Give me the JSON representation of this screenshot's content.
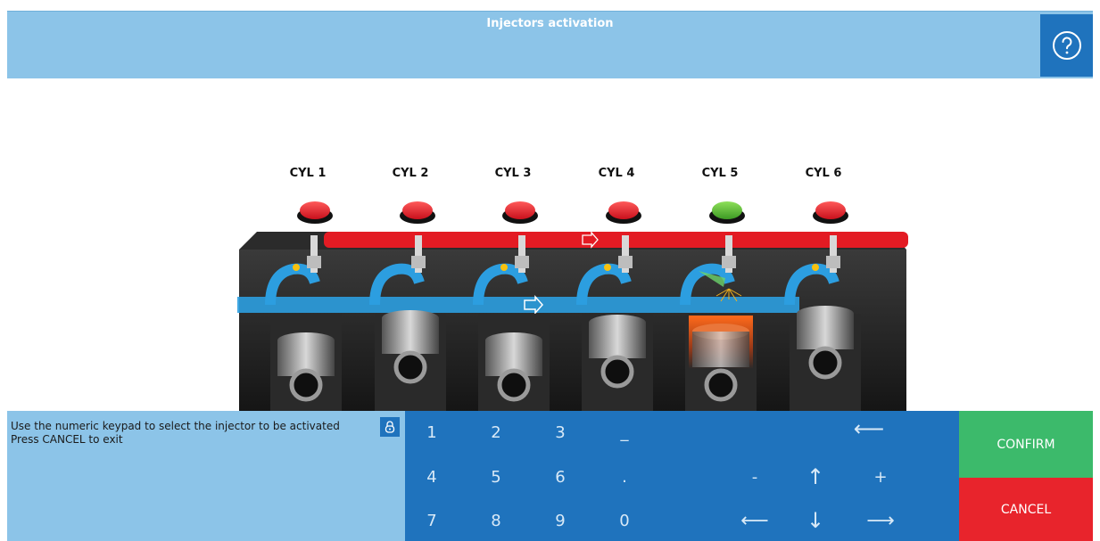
{
  "header": {
    "title": "Injectors activation",
    "help_icon": "question-circle-icon"
  },
  "cylinders": [
    {
      "label": "CYL 1",
      "status": "red"
    },
    {
      "label": "CYL 2",
      "status": "red"
    },
    {
      "label": "CYL 3",
      "status": "red"
    },
    {
      "label": "CYL 4",
      "status": "red"
    },
    {
      "label": "CYL 5",
      "status": "green"
    },
    {
      "label": "CYL 6",
      "status": "red"
    }
  ],
  "instructions": {
    "line1": "Use the numeric keypad to select the injector to be activated",
    "line2": "Press CANCEL to exit",
    "lock_icon": "lock-icon"
  },
  "keypad": {
    "k1": "1",
    "k2": "2",
    "k3": "3",
    "underscore": "_",
    "backspace": "⟵",
    "k4": "4",
    "k5": "5",
    "k6": "6",
    "dot": ".",
    "minus": "-",
    "up": "↑",
    "plus": "+",
    "k7": "7",
    "k8": "8",
    "k9": "9",
    "k0": "0",
    "left": "⟵",
    "down": "↓",
    "right": "⟶"
  },
  "actions": {
    "confirm": "CONFIRM",
    "cancel": "CANCEL"
  },
  "colors": {
    "header_bg": "#8cc4e8",
    "keypad_bg": "#1f73bd",
    "confirm_bg": "#3cba6b",
    "cancel_bg": "#e8242c",
    "status_red": "#e82630",
    "status_green": "#58b834"
  }
}
